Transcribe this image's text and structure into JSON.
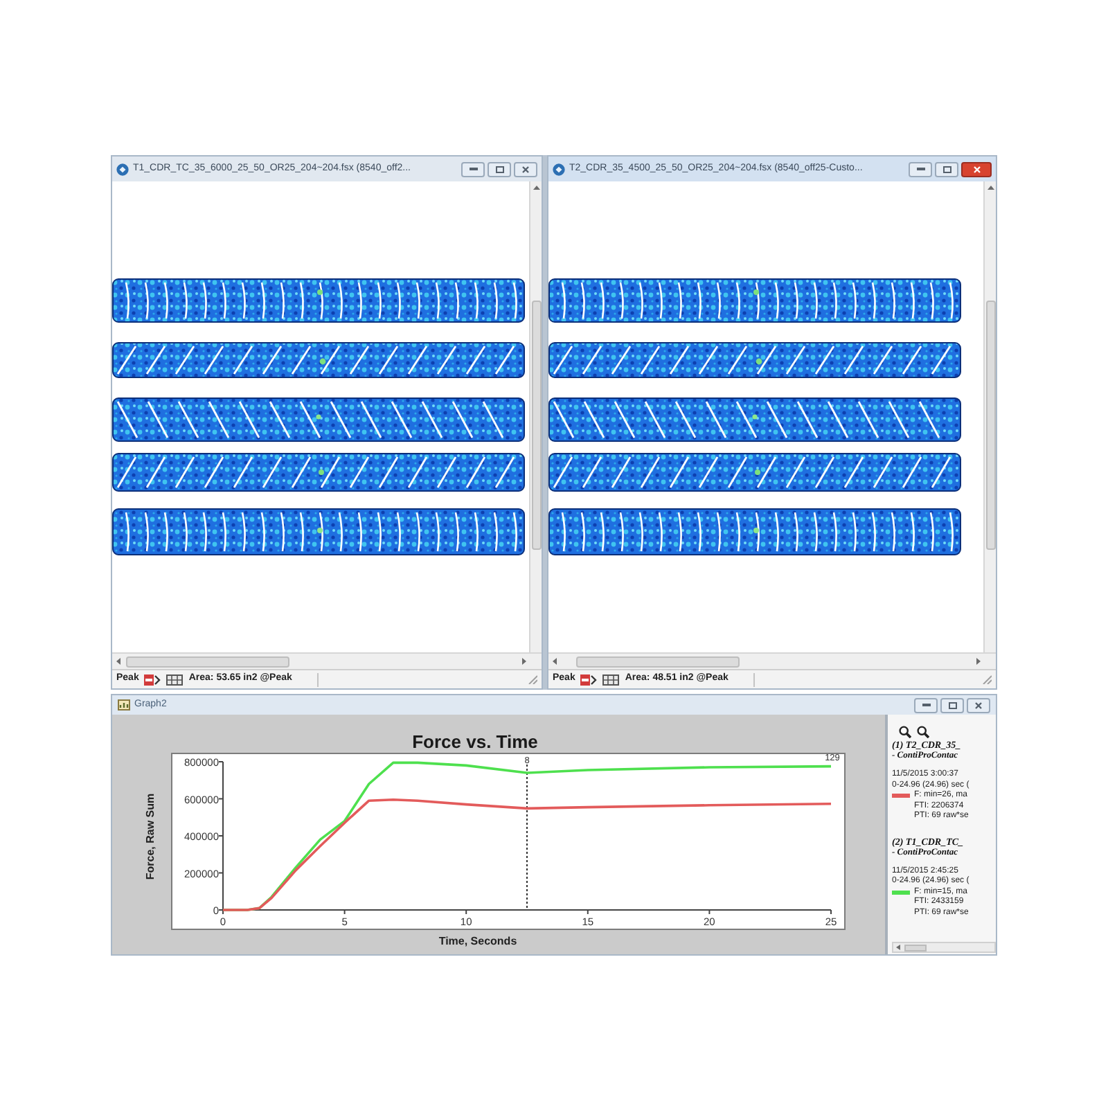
{
  "image_windows": [
    {
      "title": "T1_CDR_TC_35_6000_25_50_OR25_204~204.fsx (8540_off2...",
      "active": false,
      "status": {
        "mode": "Peak",
        "area": "Area: 53.65 in2 @Peak"
      }
    },
    {
      "title": "T2_CDR_35_4500_25_50_OR25_204~204.fsx (8540_off25-Custo...",
      "active": true,
      "status": {
        "mode": "Peak",
        "area": "Area: 48.51 in2 @Peak"
      }
    }
  ],
  "graph_window": {
    "title": "Graph2",
    "chart_data": {
      "type": "line",
      "title": "Force vs. Time",
      "xlabel": "Time, Seconds",
      "ylabel": "Force, Raw Sum",
      "x": [
        0,
        1,
        1.5,
        2,
        3,
        4,
        5,
        6,
        7,
        8,
        10,
        12.5,
        15,
        20,
        25
      ],
      "series": [
        {
          "color": "#4ee04e",
          "values": [
            0,
            0,
            10000,
            70000,
            230000,
            380000,
            480000,
            680000,
            795000,
            795000,
            780000,
            740000,
            755000,
            770000,
            775000
          ]
        },
        {
          "color": "#e35b5b",
          "values": [
            0,
            0,
            10000,
            65000,
            215000,
            345000,
            470000,
            590000,
            595000,
            590000,
            570000,
            548000,
            555000,
            565000,
            573000
          ]
        }
      ],
      "xlim": [
        0,
        25
      ],
      "ylim": [
        0,
        800000
      ],
      "xticks": [
        0,
        5,
        10,
        15,
        20,
        25
      ],
      "yticks": [
        0,
        200000,
        400000,
        600000,
        800000
      ],
      "ref_lines": [
        {
          "axis": "x",
          "value": 12.5
        }
      ],
      "annotations": [
        "8",
        "129"
      ]
    },
    "legend": [
      {
        "title": "(1) T2_CDR_35_",
        "subtitle": "- ContiProContac",
        "date": "11/5/2015 3:00:37",
        "range": "0-24.96 (24.96) sec (",
        "color": "#e35b5b",
        "stats": [
          "F: min=26, ma",
          "FTI: 2206374",
          "PTI: 69 raw*se"
        ]
      },
      {
        "title": "(2) T1_CDR_TC_",
        "subtitle": "- ContiProContac",
        "date": "11/5/2015 2:45:25",
        "range": "0-24.96 (24.96) sec (",
        "color": "#4ee04e",
        "stats": [
          "F: min=15, ma",
          "FTI: 2433159",
          "PTI: 69 raw*se"
        ]
      }
    ]
  }
}
